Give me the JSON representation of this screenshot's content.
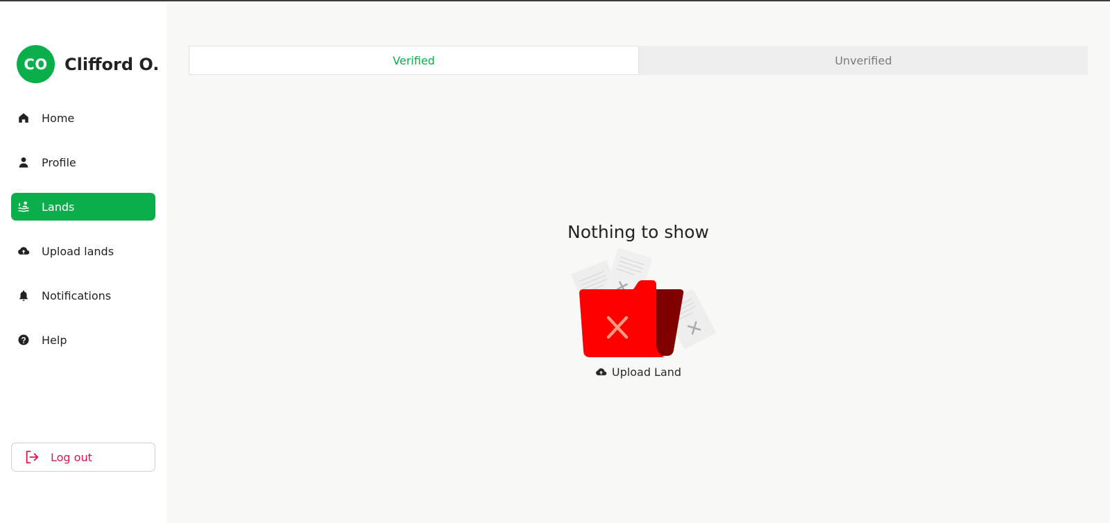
{
  "user": {
    "initials": "CO",
    "name": "Clifford O."
  },
  "sidebar": {
    "items": [
      {
        "label": "Home",
        "icon": "home-icon"
      },
      {
        "label": "Profile",
        "icon": "person-icon"
      },
      {
        "label": "Lands",
        "icon": "land-icon",
        "active": true
      },
      {
        "label": "Upload lands",
        "icon": "cloud-upload-icon"
      },
      {
        "label": "Notifications",
        "icon": "bell-icon"
      },
      {
        "label": "Help",
        "icon": "help-icon"
      }
    ],
    "logout_label": "Log out"
  },
  "tabs": {
    "verified": "Verified",
    "unverified": "Unverified",
    "active": "Verified"
  },
  "empty_state": {
    "title": "Nothing to show",
    "action_label": "Upload Land",
    "illustration": "empty-folder-illustration"
  },
  "colors": {
    "accent": "#0aaf4c",
    "logout": "#e0134b",
    "folder": "#ff0000",
    "folder_back": "#800000",
    "main_bg": "#f8f8f6"
  }
}
